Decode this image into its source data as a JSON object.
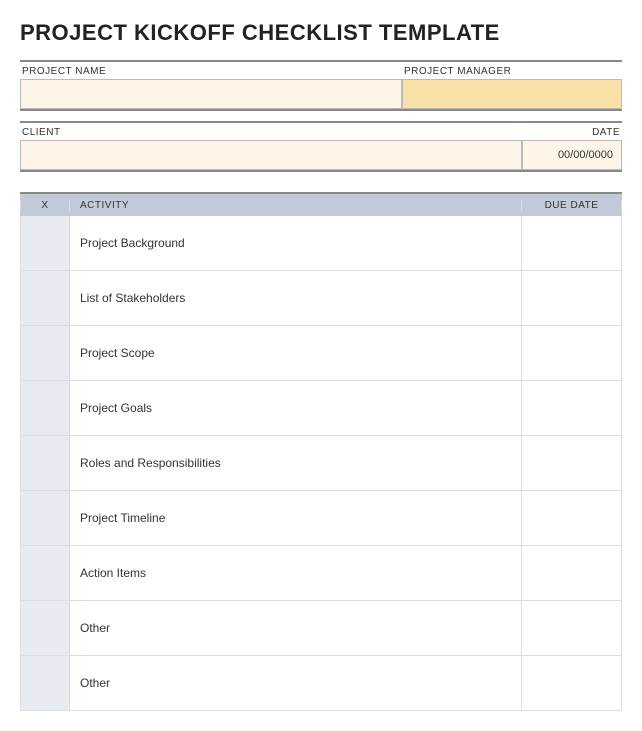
{
  "title": "PROJECT KICKOFF CHECKLIST TEMPLATE",
  "info": {
    "project_name_label": "PROJECT NAME",
    "project_name_value": "",
    "project_manager_label": "PROJECT MANAGER",
    "project_manager_value": "",
    "client_label": "CLIENT",
    "client_value": "",
    "date_label": "DATE",
    "date_value": "00/00/0000"
  },
  "checklist": {
    "header_x": "X",
    "header_activity": "ACTIVITY",
    "header_due": "DUE DATE",
    "rows": [
      {
        "x": "",
        "activity": "Project Background",
        "due": ""
      },
      {
        "x": "",
        "activity": "List of Stakeholders",
        "due": ""
      },
      {
        "x": "",
        "activity": "Project Scope",
        "due": ""
      },
      {
        "x": "",
        "activity": "Project Goals",
        "due": ""
      },
      {
        "x": "",
        "activity": "Roles and Responsibilities",
        "due": ""
      },
      {
        "x": "",
        "activity": "Project Timeline",
        "due": ""
      },
      {
        "x": "",
        "activity": "Action Items",
        "due": ""
      },
      {
        "x": "",
        "activity": "Other",
        "due": ""
      },
      {
        "x": "",
        "activity": "Other",
        "due": ""
      }
    ]
  }
}
